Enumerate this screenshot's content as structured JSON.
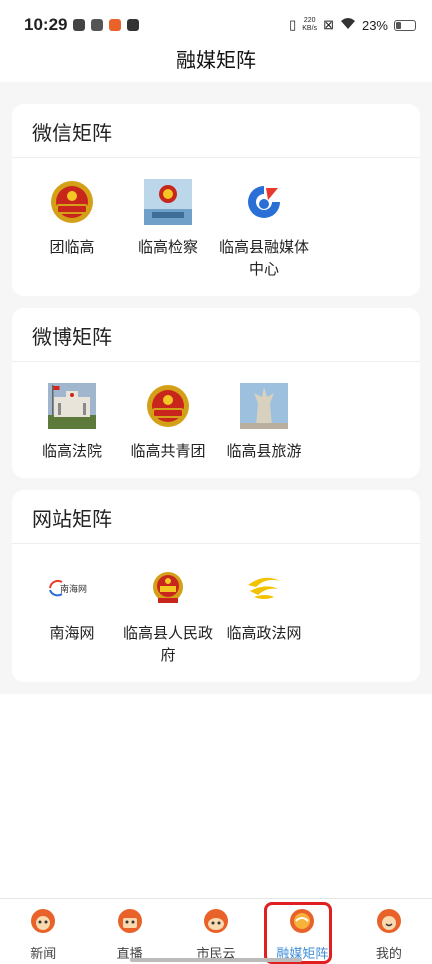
{
  "status_bar": {
    "time": "10:29",
    "net_speed_value": "220",
    "net_speed_unit": "KB/s",
    "battery": "23%",
    "battery_level": 0.23
  },
  "header": {
    "title": "融媒矩阵"
  },
  "sections": [
    {
      "title": "微信矩阵",
      "items": [
        {
          "label": "团临高",
          "icon": "youth-league-emblem-icon"
        },
        {
          "label": "临高检察",
          "icon": "procuratorate-emblem-icon"
        },
        {
          "label": "临高县融媒体中心",
          "icon": "media-center-logo-icon"
        }
      ]
    },
    {
      "title": "微博矩阵",
      "items": [
        {
          "label": "临高法院",
          "icon": "court-building-icon"
        },
        {
          "label": "临高共青团",
          "icon": "youth-league-emblem-icon"
        },
        {
          "label": "临高县旅游",
          "icon": "statue-photo-icon"
        }
      ]
    },
    {
      "title": "网站矩阵",
      "items": [
        {
          "label": "南海网",
          "icon": "nanhai-logo-icon",
          "logo_text": "南海网"
        },
        {
          "label": "临高县人民政府",
          "icon": "national-emblem-icon"
        },
        {
          "label": "临高政法网",
          "icon": "yellow-swirl-logo-icon"
        }
      ]
    }
  ],
  "tabbar": [
    {
      "label": "新闻",
      "active": false
    },
    {
      "label": "直播",
      "active": false
    },
    {
      "label": "市民云",
      "active": false
    },
    {
      "label": "融媒矩阵",
      "active": true
    },
    {
      "label": "我的",
      "active": false
    }
  ],
  "colors": {
    "accent": "#3e8ed8",
    "highlight": "#e02020",
    "tab_icon": "#e8622a"
  }
}
